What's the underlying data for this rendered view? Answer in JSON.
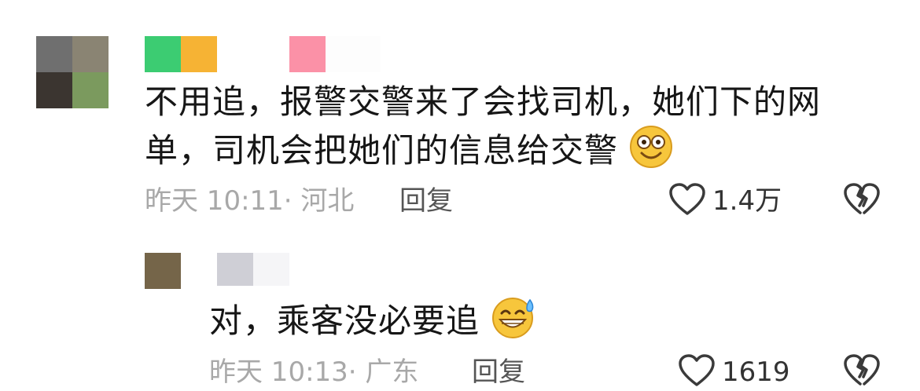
{
  "comments": [
    {
      "text_line1": "不用追，报警交警来了会找司机，她们下的网",
      "text_line2": "单，司机会把她们的信息给交警",
      "emoji": "smiling-face-emoji",
      "time": "昨天 10:11",
      "location": "· 河北",
      "reply_label": "回复",
      "like_count": "1.4万"
    },
    {
      "text": "对，乘客没必要追",
      "emoji": "grinning-sweat-emoji",
      "time": "昨天 10:13",
      "location": "· 广东",
      "reply_label": "回复",
      "like_count": "1619"
    }
  ],
  "colors": {
    "text": "#161616",
    "meta": "#a8a8a8",
    "icon": "#333333"
  }
}
